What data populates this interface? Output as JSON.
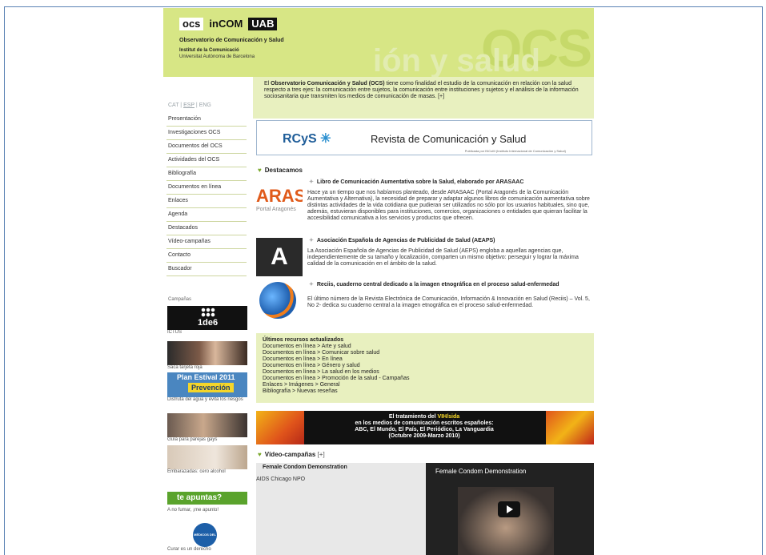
{
  "header": {
    "logo_ocs": "ocs",
    "logo_incom": "inCOM",
    "logo_uab": "UAB",
    "title": "Observatorio de Comunicación y Salud",
    "institute": "Institut de la Comunicació",
    "university": "Universitat Autònoma de Barcelona",
    "watermark": "OCS",
    "watermark2": "ión y salud"
  },
  "lang": {
    "cat": "CAT",
    "sep1": " | ",
    "esp": "ESP",
    "sep2": " | ",
    "eng": "ENG"
  },
  "menu": [
    "Presentación",
    "Investigaciones OCS",
    "Documentos del OCS",
    "Actividades del OCS",
    "Bibliografía",
    "Documentos en línea",
    "Enlaces",
    "Agenda",
    "Destacados",
    "Vídeo-campañas",
    "Contacto",
    "Buscador"
  ],
  "campaigns": {
    "title": "Campañas",
    "items": [
      {
        "img": "1de6",
        "caption": "ICTUS"
      },
      {
        "caption": "Saca tarjeta roja"
      },
      {
        "img_title": "Plan Estival 2011",
        "img_sub": "Prevención",
        "caption": "Disfruta del agua y evita los riesgos"
      },
      {
        "caption": "Guía para parejas gays"
      },
      {
        "caption": "Embarazadas: cero alcohol"
      },
      {
        "img": "te apuntas?",
        "caption": "A no fumar, ¡me apunto!"
      },
      {
        "img": "MÉDICOS DEL MUNDO",
        "caption": "Curar es un derecho"
      }
    ]
  },
  "intro": {
    "text_a": "El ",
    "bold": "Observatorio Comunicación y Salud (OCS)",
    "text_b": " tiene como finalidad el estudio de la comunicación en relación con la salud respecto a tres ejes: la comunicación entre sujetos, la comunicación entre instituciones y sujetos y el análisis de la información sociosanitaria que transmiten los medios de comunicación de masas. [+]"
  },
  "rcys": {
    "logo": "RCyS",
    "title": "Revista de Comunicación y Salud",
    "small": "Publicada por INCoM (Instituto Internacional de Comunicación y Salud)"
  },
  "destacamos": "Destacamos",
  "news": [
    {
      "img": "ARASAAC",
      "img_sub": "Portal Aragonés",
      "title": "Libro de Comunicación Aumentativa sobre la Salud, elaborado por ARASAAC",
      "body": "Hace ya un tiempo que nos habíamos planteado, desde ARASAAC (Portal Aragonés de la Comunicación Aumentativa y Alternativa), la necesidad de preparar y adaptar algunos libros de comunicación aumentativa sobre distintas actividades de la vida cotidiana que pudieran ser utilizados no sólo por los usuarios habituales, sino que, además, estuvieran disponibles para instituciones, comercios, organizaciones o entidades que quieran facilitar la accesibilidad comunicativa a los servicios y productos que ofrecen."
    },
    {
      "img": "A",
      "title": "Asociación Española de Agencias de Publicidad de Salud (AEAPS)",
      "body": "La Asociación Española de Agencias de Publicidad de Salud (AEPS) engloba a aquellas agencias que, independientemente de su tamaño y localización, comparten un mismo objetivo: perseguir y lograr la máxima calidad de la comunicación en el ámbito de la salud."
    },
    {
      "title": "Reciis, cuaderno central dedicado a la imagen etnográfica en el proceso salud-enfermedad",
      "body": "El último número de la Revista Electrónica de Comunicación, Información & Innovación en Salud (Reciis) – Vol. 5, No 2- dedica su cuaderno central a la imagen etnográfica en el proceso salud-enfermedad."
    }
  ],
  "recursos": {
    "title": "Últimos recursos actualizados",
    "items": [
      "Documentos en línea > Arte y salud",
      "Documentos en línea > Comunicar sobre salud",
      "Documentos en línea > En línea",
      "Documentos en línea > Género y salud",
      "Documentos en línea > La salud en los medios",
      "Documentos en línea > Promoción de la salud - Campañas",
      "Enlaces > Imágenes > General",
      "Bibliografía > Nuevas reseñas"
    ]
  },
  "vih": {
    "line1a": "El tratamiento del ",
    "line1b": "VIH/sida",
    "line2": "en los medios de comunicación escritos españoles:",
    "line3": "ABC, El Mundo, El País, El Periódico, La Vanguardia",
    "line4": "(Octubre 2009-Marzo 2010)"
  },
  "videos": {
    "title": "Vídeo-campañas",
    "more": "[+]",
    "item_title": "Female Condom Demonstration",
    "channel": "AIDS Chicago NPO",
    "player_title": "Female Condom Demonstration"
  }
}
